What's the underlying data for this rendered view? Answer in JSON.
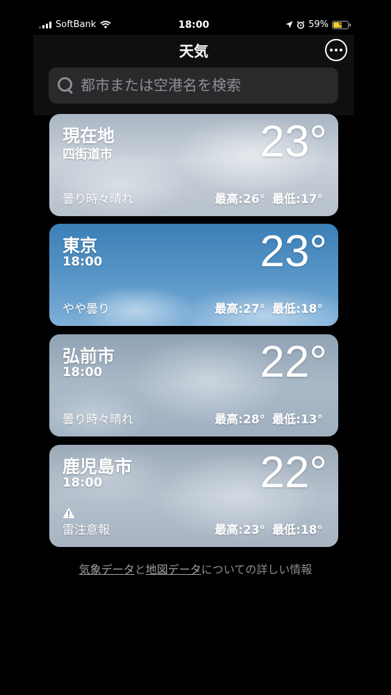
{
  "status_bar": {
    "carrier": "SoftBank",
    "time": "18:00",
    "battery": "59%",
    "battery_level": 0.59
  },
  "header": {
    "title": "天気",
    "more_icon": "ellipsis-circle-icon"
  },
  "search": {
    "placeholder": "都市または空港名を検索",
    "icon": "search-icon"
  },
  "cards": [
    {
      "name": "現在地",
      "subtitle": "四街道市",
      "temperature": "23°",
      "condition": "曇り時々晴れ",
      "high": "最高:26°",
      "low": "最低:17°"
    },
    {
      "name": "東京",
      "subtitle": "18:00",
      "temperature": "23°",
      "condition": "やや曇り",
      "high": "最高:27°",
      "low": "最低:18°"
    },
    {
      "name": "弘前市",
      "subtitle": "18:00",
      "temperature": "22°",
      "condition": "曇り時々晴れ",
      "high": "最高:28°",
      "low": "最低:13°"
    },
    {
      "name": "鹿児島市",
      "subtitle": "18:00",
      "temperature": "22°",
      "condition": "雷注意報",
      "high": "最高:23°",
      "low": "最低:18°",
      "warning_icon": "warning-triangle-icon"
    }
  ],
  "footer": {
    "link1": "気象データ",
    "connector": "と",
    "link2": "地図データ",
    "suffix": "についての詳しい情報"
  }
}
